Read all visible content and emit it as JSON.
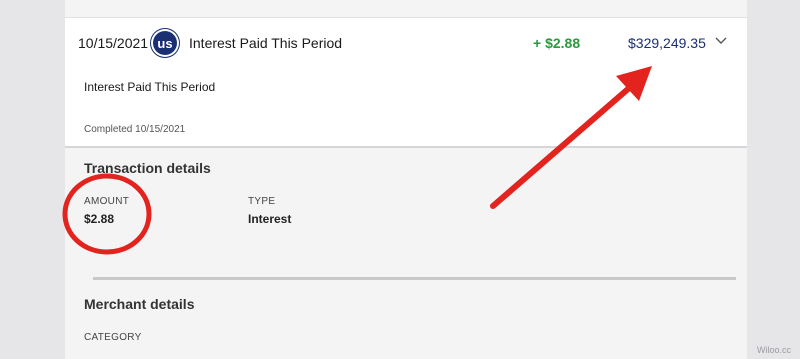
{
  "transaction": {
    "date": "10/15/2021",
    "logo_text": "us",
    "description": "Interest Paid This Period",
    "amount": "+ $2.88",
    "balance": "$329,249.35"
  },
  "detail": {
    "title": "Interest Paid This Period",
    "completed": "Completed 10/15/2021"
  },
  "transaction_details": {
    "heading": "Transaction details",
    "amount_label": "AMOUNT",
    "amount_value": "$2.88",
    "type_label": "TYPE",
    "type_value": "Interest"
  },
  "merchant_details": {
    "heading": "Merchant details",
    "category_label": "CATEGORY"
  },
  "annotations": {
    "color": "#e3231d"
  },
  "watermark": "Wiloo.cc",
  "colors": {
    "amount_positive": "#2a9a3c",
    "balance": "#1b2f73",
    "logo_bg": "#1b2f73"
  }
}
